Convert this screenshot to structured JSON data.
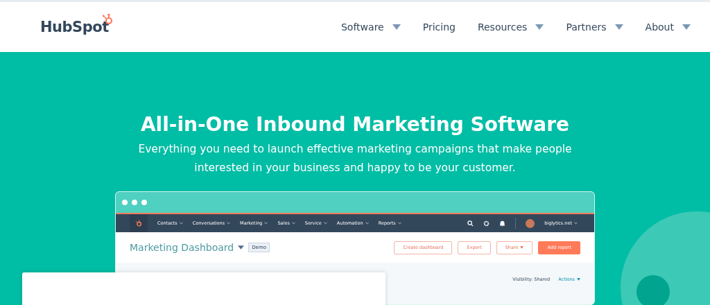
{
  "logo": {
    "text": "HubSpot"
  },
  "nav": [
    {
      "label": "Software",
      "has_menu": true
    },
    {
      "label": "Pricing",
      "has_menu": false
    },
    {
      "label": "Resources",
      "has_menu": true
    },
    {
      "label": "Partners",
      "has_menu": true
    },
    {
      "label": "About",
      "has_menu": true
    }
  ],
  "hero": {
    "title": "All-in-One Inbound Marketing Software",
    "subtitle": "Everything you need to launch effective marketing campaigns that make people interested in your business and happy to be your customer."
  },
  "app_preview": {
    "nav": [
      "Contacts",
      "Conversations",
      "Marketing",
      "Sales",
      "Service",
      "Automation",
      "Reports"
    ],
    "account": "biglytics.net",
    "dashboard_title": "Marketing Dashboard",
    "badge": "Demo",
    "buttons": [
      {
        "label": "Create dashboard",
        "kind": "outline",
        "has_menu": false
      },
      {
        "label": "Export",
        "kind": "outline",
        "has_menu": false
      },
      {
        "label": "Share",
        "kind": "outline",
        "has_menu": true
      },
      {
        "label": "Add report",
        "kind": "primary",
        "has_menu": false
      }
    ],
    "visibility_label": "Visibility:",
    "visibility_value": "Shared",
    "actions": "Actions"
  }
}
